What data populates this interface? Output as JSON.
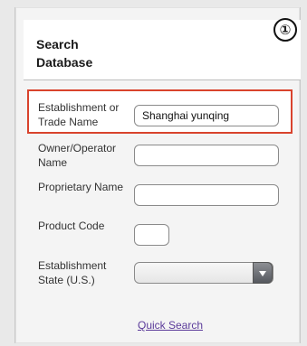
{
  "step_badge": "①",
  "header": {
    "title": "Search Database"
  },
  "form": {
    "fields": [
      {
        "label": "Establishment or Trade Name",
        "value": "Shanghai yunqing"
      },
      {
        "label": "Owner/Operator Name",
        "value": ""
      },
      {
        "label": "Proprietary Name",
        "value": ""
      },
      {
        "label": "Product Code",
        "value": ""
      },
      {
        "label": "Establishment State (U.S.)",
        "value": ""
      }
    ]
  },
  "links": {
    "quick_search": "Quick Search"
  },
  "colors": {
    "highlight": "#d9432d",
    "link": "#5b3b9a"
  }
}
